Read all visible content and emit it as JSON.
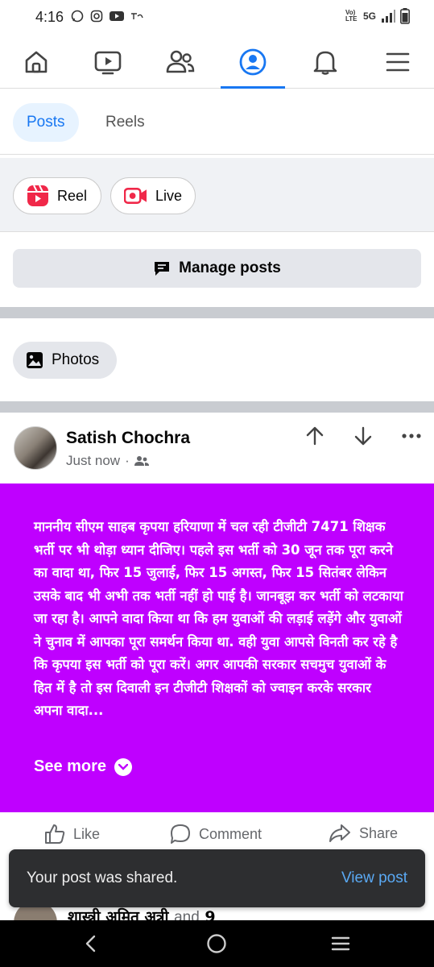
{
  "status_bar": {
    "time": "4:16",
    "left_icons": [
      "whatsapp-icon",
      "instagram-icon",
      "youtube-icon",
      "notification-app-icon"
    ],
    "network": "5G",
    "volte": "Vo) LTE",
    "right_icons": [
      "signal-icon",
      "battery-icon"
    ]
  },
  "top_nav": {
    "items": [
      "home-icon",
      "video-icon",
      "friends-icon",
      "profile-icon",
      "notifications-icon",
      "menu-icon"
    ],
    "active": "profile-icon",
    "accent": "#1877f2"
  },
  "tabs": [
    {
      "label": "Posts",
      "active": true
    },
    {
      "label": "Reels",
      "active": false
    }
  ],
  "create": {
    "reel_label": "Reel",
    "live_label": "Live"
  },
  "manage_posts_label": "Manage posts",
  "photos_label": "Photos",
  "post": {
    "author": "Satish Chochra",
    "time": "Just now",
    "separator": "·",
    "audience_icon": "friends-audience-icon",
    "background": "#bf00ff",
    "text": "माननीय सीएम साहब कृपया हरियाणा में चल रही टीजीटी 7471 शिक्षक भर्ती पर भी थोड़ा ध्यान दीजिए। पहले इस भर्ती को 30 जून तक पूरा करने का वादा था, फिर 15 जुलाई, फिर 15 अगस्त, फिर 15 सितंबर  लेकिन उसके बाद भी अभी तक भर्ती नहीं हो पाई है। जानबूझ कर भर्ती को लटकाया जा रहा है। आपने वादा किया था कि हम युवाओं की लड़ाई लड़ेंगे और युवाओं ने चुनाव में आपका पूरा समर्थन किया था. वही युवा आपसे विनती कर रहे है कि कृपया इस भर्ती को पूरा करें। अगर आपकी सरकार सचमुच युवाओं के हित में है तो इस दिवाली इन टीजीटी शिक्षकों को ज्वाइन करके सरकार अपना वादा...",
    "see_more": "See more",
    "actions": {
      "like": "Like",
      "comment": "Comment",
      "share": "Share"
    }
  },
  "next_post_peek": {
    "name": "शास्त्री अमित अत्री",
    "and_text": "and",
    "count": "9"
  },
  "snackbar": {
    "message": "Your post was shared.",
    "action": "View post"
  },
  "system_nav": [
    "back-icon",
    "home-circle-icon",
    "recents-icon"
  ]
}
